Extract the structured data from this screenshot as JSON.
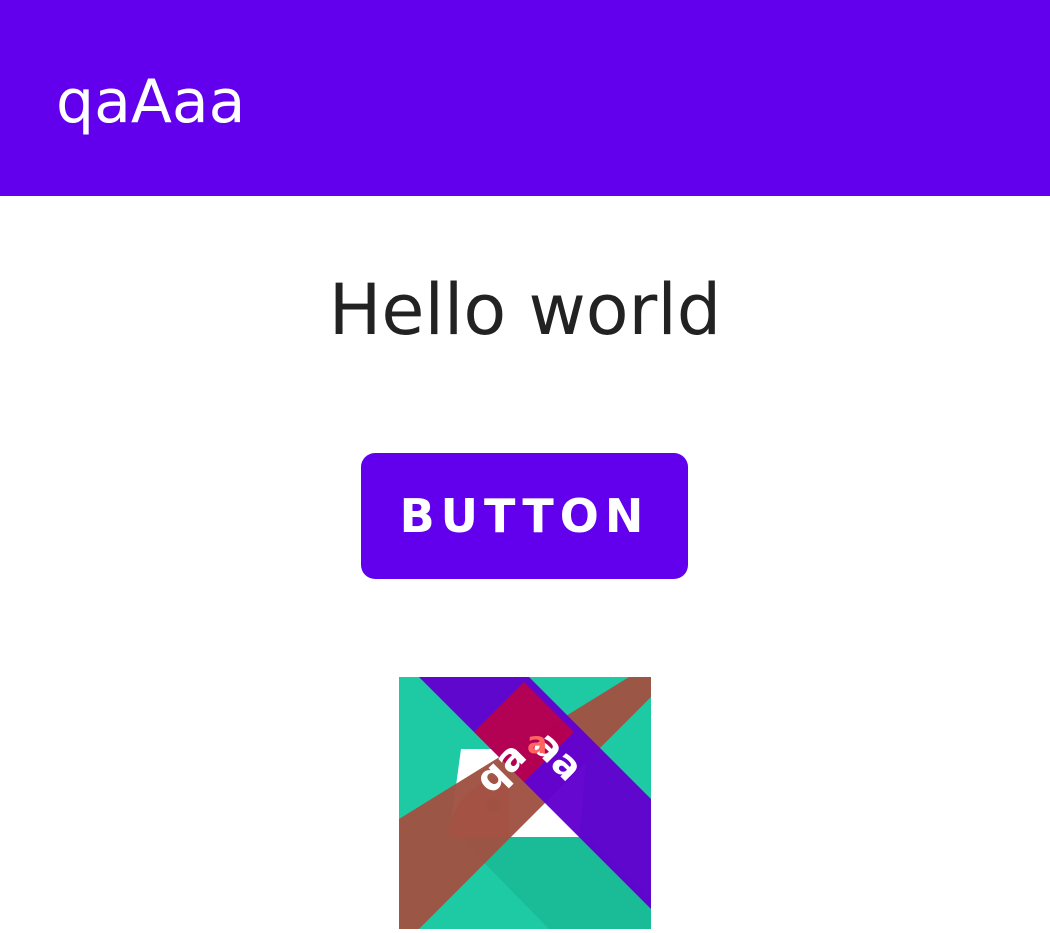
{
  "app_bar": {
    "title": "qaAaa",
    "color": "#6200EE"
  },
  "main": {
    "greeting": "Hello world",
    "button_label": "BUTTON"
  },
  "logo": {
    "icon": "app-logo-icon",
    "text": "qaaaa",
    "colors": {
      "background": "#1ECAA4",
      "purple_stripe": "#6200D0",
      "brown_stripe": "#A05242",
      "overlap": "#C2003E",
      "accent": "#FF6461"
    }
  }
}
